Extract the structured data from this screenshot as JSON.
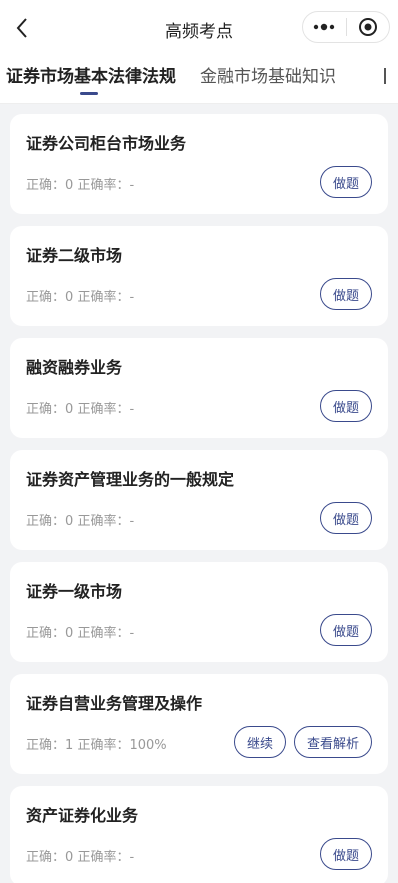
{
  "header": {
    "title": "高频考点",
    "back_icon": "chevron-left-icon",
    "more_icon": "more-dots-icon",
    "minimize_icon": "minimize-icon",
    "close_icon": "target-close-icon"
  },
  "tabs": [
    {
      "label": "证券市场基本法律法规",
      "active": true
    },
    {
      "label": "金融市场基础知识",
      "active": false
    }
  ],
  "cards": [
    {
      "title": "证券公司柜台市场业务",
      "correct_label": "正确：",
      "correct": "0",
      "rate_label": "正确率：",
      "rate": "-",
      "buttons": [
        "做题"
      ]
    },
    {
      "title": "证券二级市场",
      "correct_label": "正确：",
      "correct": "0",
      "rate_label": "正确率：",
      "rate": "-",
      "buttons": [
        "做题"
      ]
    },
    {
      "title": "融资融券业务",
      "correct_label": "正确：",
      "correct": "0",
      "rate_label": "正确率：",
      "rate": "-",
      "buttons": [
        "做题"
      ]
    },
    {
      "title": "证券资产管理业务的一般规定",
      "correct_label": "正确：",
      "correct": "0",
      "rate_label": "正确率：",
      "rate": "-",
      "buttons": [
        "做题"
      ]
    },
    {
      "title": "证券一级市场",
      "correct_label": "正确：",
      "correct": "0",
      "rate_label": "正确率：",
      "rate": "-",
      "buttons": [
        "做题"
      ]
    },
    {
      "title": "证券自营业务管理及操作",
      "correct_label": "正确：",
      "correct": "1",
      "rate_label": "正确率：",
      "rate": "100%",
      "buttons": [
        "继续",
        "查看解析"
      ]
    },
    {
      "title": "资产证券化业务",
      "correct_label": "正确：",
      "correct": "0",
      "rate_label": "正确率：",
      "rate": "-",
      "buttons": [
        "做题"
      ]
    }
  ],
  "colors": {
    "accent": "#3a4a8c",
    "background": "#f2f3f5",
    "muted_text": "#999999"
  }
}
